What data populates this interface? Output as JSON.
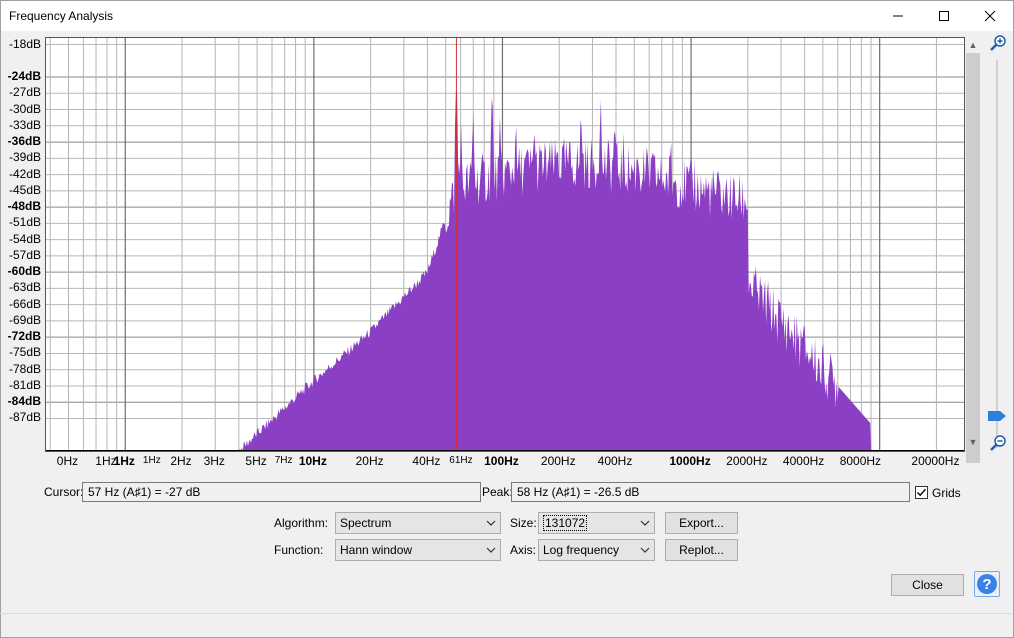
{
  "window": {
    "title": "Frequency Analysis",
    "minimize_icon": "minimize-icon",
    "maximize_icon": "maximize-icon",
    "close_icon": "close-icon"
  },
  "plot": {
    "y_ticks": [
      {
        "label": "-18dB",
        "db": -18,
        "major": false
      },
      {
        "label": "-24dB",
        "db": -24,
        "major": true
      },
      {
        "label": "-27dB",
        "db": -27,
        "major": false
      },
      {
        "label": "-30dB",
        "db": -30,
        "major": false
      },
      {
        "label": "-33dB",
        "db": -33,
        "major": false
      },
      {
        "label": "-36dB",
        "db": -36,
        "major": true
      },
      {
        "label": "-39dB",
        "db": -39,
        "major": false
      },
      {
        "label": "-42dB",
        "db": -42,
        "major": false
      },
      {
        "label": "-45dB",
        "db": -45,
        "major": false
      },
      {
        "label": "-48dB",
        "db": -48,
        "major": true
      },
      {
        "label": "-51dB",
        "db": -51,
        "major": false
      },
      {
        "label": "-54dB",
        "db": -54,
        "major": false
      },
      {
        "label": "-57dB",
        "db": -57,
        "major": false
      },
      {
        "label": "-60dB",
        "db": -60,
        "major": true
      },
      {
        "label": "-63dB",
        "db": -63,
        "major": false
      },
      {
        "label": "-66dB",
        "db": -66,
        "major": false
      },
      {
        "label": "-69dB",
        "db": -69,
        "major": false
      },
      {
        "label": "-72dB",
        "db": -72,
        "major": true
      },
      {
        "label": "-75dB",
        "db": -75,
        "major": false
      },
      {
        "label": "-78dB",
        "db": -78,
        "major": false
      },
      {
        "label": "-81dB",
        "db": -81,
        "major": false
      },
      {
        "label": "-84dB",
        "db": -84,
        "major": true
      },
      {
        "label": "-87dB",
        "db": -87,
        "major": false
      }
    ],
    "x_ticks": [
      {
        "label": "0Hz",
        "hz": 0.5,
        "major": false,
        "small": false
      },
      {
        "label": "1Hz",
        "hz": 0.8,
        "major": false,
        "small": false
      },
      {
        "label": "1Hz",
        "hz": 1,
        "major": true,
        "small": false
      },
      {
        "label": "1Hz",
        "hz": 1.4,
        "major": false,
        "small": true
      },
      {
        "label": "2Hz",
        "hz": 2,
        "major": false,
        "small": false
      },
      {
        "label": "3Hz",
        "hz": 3,
        "major": false,
        "small": false
      },
      {
        "label": "5Hz",
        "hz": 5,
        "major": false,
        "small": false
      },
      {
        "label": "7Hz",
        "hz": 7,
        "major": false,
        "small": true
      },
      {
        "label": "10Hz",
        "hz": 10,
        "major": true,
        "small": false
      },
      {
        "label": "20Hz",
        "hz": 20,
        "major": false,
        "small": false
      },
      {
        "label": "40Hz",
        "hz": 40,
        "major": false,
        "small": false
      },
      {
        "label": "61Hz",
        "hz": 61,
        "major": false,
        "small": true
      },
      {
        "label": "100Hz",
        "hz": 100,
        "major": true,
        "small": false
      },
      {
        "label": "200Hz",
        "hz": 200,
        "major": false,
        "small": false
      },
      {
        "label": "400Hz",
        "hz": 400,
        "major": false,
        "small": false
      },
      {
        "label": "1000Hz",
        "hz": 1000,
        "major": true,
        "small": false
      },
      {
        "label": "2000Hz",
        "hz": 2000,
        "major": false,
        "small": false
      },
      {
        "label": "4000Hz",
        "hz": 4000,
        "major": false,
        "small": false
      },
      {
        "label": "8000Hz",
        "hz": 8000,
        "major": false,
        "small": false
      },
      {
        "label": "20000Hz",
        "hz": 20000,
        "major": false,
        "small": false
      }
    ],
    "fill_color": "#8b3fc4",
    "cursor_color": "#d03030",
    "cursor_hz": 57
  },
  "readouts": {
    "cursor_label": "Cursor:",
    "cursor_value": "57 Hz (A♯1) = -27 dB",
    "peak_label": "Peak:",
    "peak_value": "58 Hz (A♯1) = -26.5 dB",
    "grids_label": "Grids",
    "grids_checked": true
  },
  "controls": {
    "algorithm_label": "Algorithm:",
    "algorithm_value": "Spectrum",
    "function_label": "Function:",
    "function_value": "Hann window",
    "size_label": "Size:",
    "size_value": "131072",
    "axis_label": "Axis:",
    "axis_value": "Log frequency",
    "export_label": "Export...",
    "replot_label": "Replot...",
    "close_label": "Close",
    "help_label": "?"
  }
}
